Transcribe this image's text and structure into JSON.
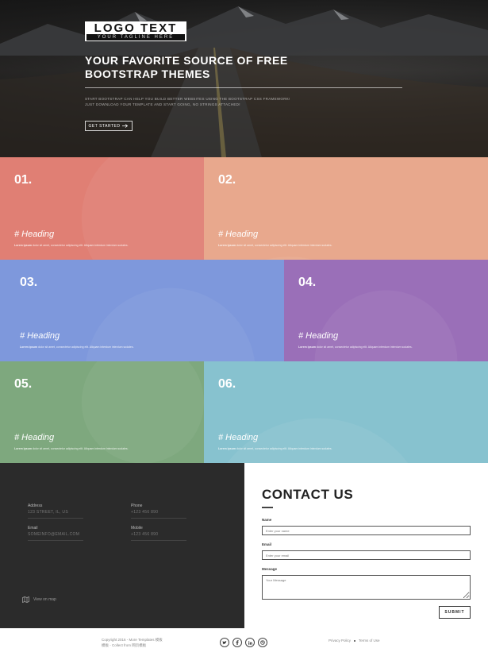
{
  "hero": {
    "logo_title": "LOGO TEXT",
    "logo_tagline": "YOUR TAGLINE HERE",
    "title": "YOUR FAVORITE SOURCE OF FREE BOOTSTRAP THEMES",
    "description": "START BOOTSTRAP CAN HELP YOU BUILD BETTER WEBSITES USING THE BOOTSTRAP CSS FRAMEWORK! JUST DOWNLOAD YOUR TEMPLATE AND START GOING, NO STRINGS ATTACHED!",
    "cta_label": "GET STARTED"
  },
  "tiles": [
    {
      "number": "01.",
      "heading": "# Heading",
      "desc_bold": "Lorem ipsum",
      "desc": "dolor sit amet, consectetur adipiscing elit. Aliquam interdum interdum sodales.",
      "color": "#e07f74"
    },
    {
      "number": "02.",
      "heading": "# Heading",
      "desc_bold": "Lorem ipsum",
      "desc": "dolor sit amet, consectetur adipiscing elit. Aliquam interdum interdum sodales.",
      "color": "#e8a88d"
    },
    {
      "number": "03.",
      "heading": "# Heading",
      "desc_bold": "Lorem ipsum",
      "desc": "dolor sit amet, consectetur adipiscing elit. Aliquam interdum interdum sodales.",
      "color": "#7e98dc"
    },
    {
      "number": "04.",
      "heading": "# Heading",
      "desc_bold": "Lorem ipsum",
      "desc": "dolor sit amet, consectetur adipiscing elit. Aliquam interdum interdum sodales.",
      "color": "#9a6fb8"
    },
    {
      "number": "05.",
      "heading": "# Heading",
      "desc_bold": "Lorem ipsum",
      "desc": "dolor sit amet, consectetur adipiscing elit. Aliquam interdum interdum sodales.",
      "color": "#7ea87e"
    },
    {
      "number": "06.",
      "heading": "# Heading",
      "desc_bold": "Lorem ipsum",
      "desc": "dolor sit amet, consectetur adipiscing elit. Aliquam interdum interdum sodales.",
      "color": "#87c2cf"
    }
  ],
  "footer": {
    "address_label": "Address",
    "address_value": "123 STREET, IL, US",
    "phone_label": "Phone",
    "phone_value": "+123 456 890",
    "email_label": "Email",
    "email_value": "SOMEINFO@EMAIL.COM",
    "mobile_label": "Mobile",
    "mobile_value": "+123 456 890",
    "map_label": "View on map"
  },
  "contact": {
    "title": "CONTACT US",
    "name_label": "Name",
    "name_placeholder": "Enter your name",
    "email_label": "Email",
    "email_placeholder": "Enter your email",
    "message_label": "Message",
    "message_placeholder": "Your Message",
    "submit_label": "SUBMIT"
  },
  "bottom": {
    "copyright_line1": "Copyright 2016 - More Templates 模板",
    "copyright_line2": "模板 - Collect from 网页模板",
    "socials": [
      "twitter-icon",
      "facebook-icon",
      "linkedin-icon",
      "dribbble-icon"
    ],
    "privacy_label": "Privacy Policy",
    "terms_label": "Terms of Use"
  },
  "colors": {
    "dark_footer": "#2b2b2b",
    "tile_1": "#e07f74",
    "tile_2": "#e8a88d",
    "tile_3": "#7e98dc",
    "tile_4": "#9a6fb8",
    "tile_5": "#7ea87e",
    "tile_6": "#87c2cf"
  }
}
